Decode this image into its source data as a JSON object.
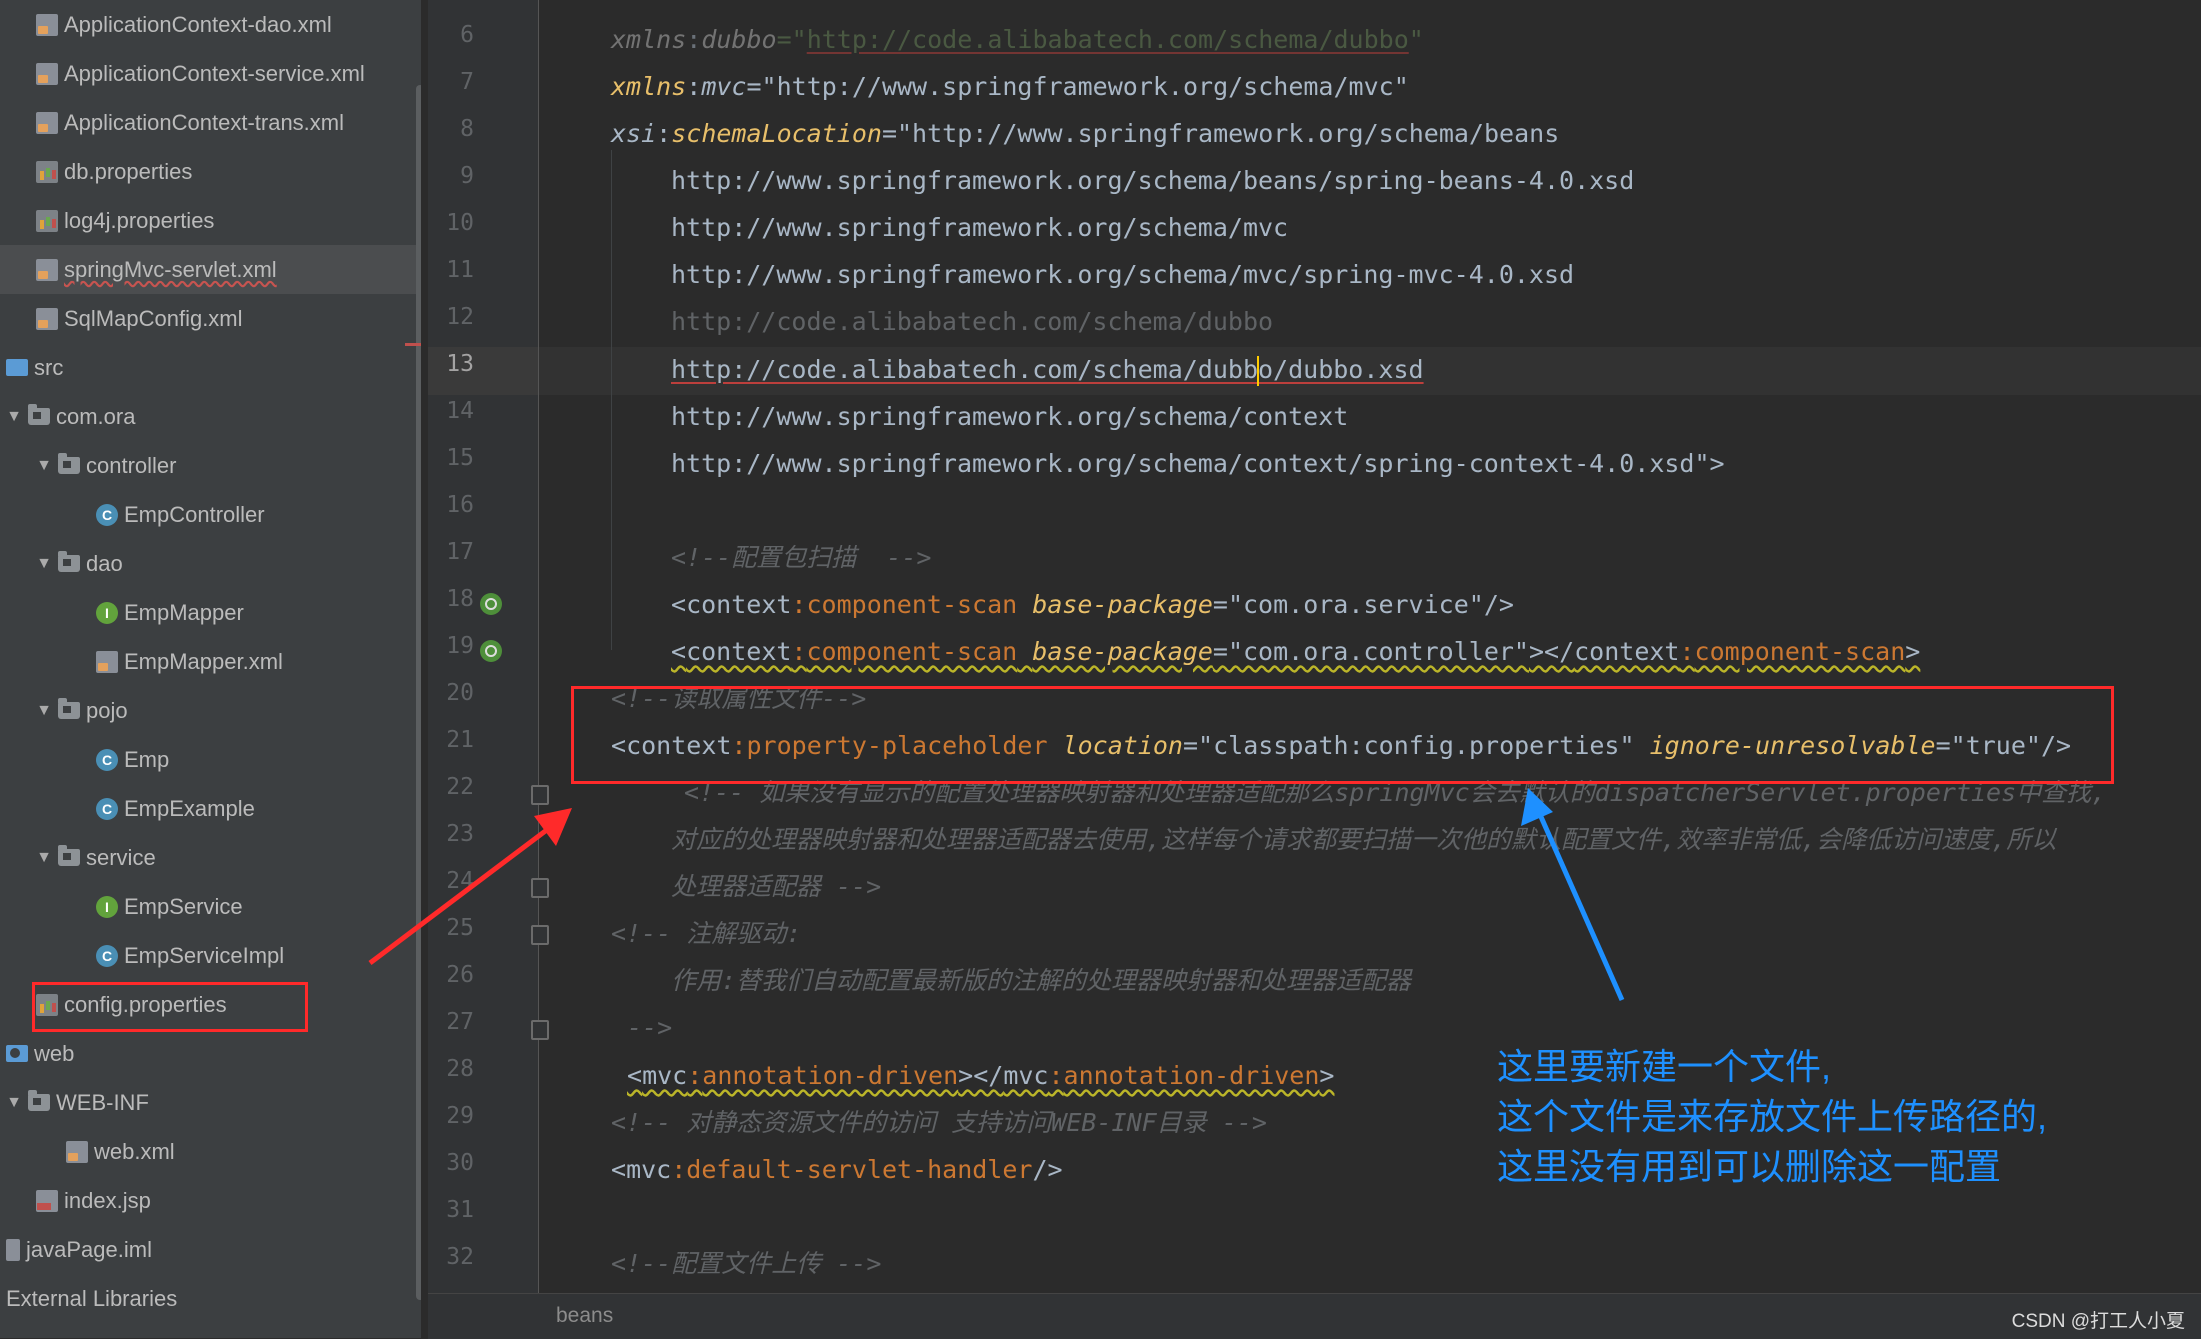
{
  "project_tree": {
    "items": [
      {
        "label": "ApplicationContext-dao.xml",
        "icon": "xml-file-icon",
        "depth": 1
      },
      {
        "label": "ApplicationContext-service.xml",
        "icon": "xml-file-icon",
        "depth": 1
      },
      {
        "label": "ApplicationContext-trans.xml",
        "icon": "xml-file-icon",
        "depth": 1
      },
      {
        "label": "db.properties",
        "icon": "properties-file-icon",
        "depth": 1
      },
      {
        "label": "log4j.properties",
        "icon": "properties-file-icon",
        "depth": 1
      },
      {
        "label": "springMvc-servlet.xml",
        "icon": "xml-file-icon",
        "depth": 1,
        "selected": true
      },
      {
        "label": "SqlMapConfig.xml",
        "icon": "xml-file-icon",
        "depth": 1
      },
      {
        "label": "src",
        "icon": "source-folder-icon",
        "depth": 0
      },
      {
        "label": "com.ora",
        "icon": "package-folder-icon",
        "depth": 0,
        "expanded": true
      },
      {
        "label": "controller",
        "icon": "package-folder-icon",
        "depth": 1,
        "expanded": true
      },
      {
        "label": "EmpController",
        "icon": "class-icon",
        "depth": 3
      },
      {
        "label": "dao",
        "icon": "package-folder-icon",
        "depth": 1,
        "expanded": true
      },
      {
        "label": "EmpMapper",
        "icon": "interface-icon",
        "depth": 3
      },
      {
        "label": "EmpMapper.xml",
        "icon": "xml-file-icon",
        "depth": 3
      },
      {
        "label": "pojo",
        "icon": "package-folder-icon",
        "depth": 1,
        "expanded": true
      },
      {
        "label": "Emp",
        "icon": "class-icon",
        "depth": 3
      },
      {
        "label": "EmpExample",
        "icon": "class-icon",
        "depth": 3
      },
      {
        "label": "service",
        "icon": "package-folder-icon",
        "depth": 1,
        "expanded": true
      },
      {
        "label": "EmpService",
        "icon": "interface-icon",
        "depth": 3
      },
      {
        "label": "EmpServiceImpl",
        "icon": "class-icon",
        "depth": 3
      },
      {
        "label": "config.properties",
        "icon": "properties-file-icon",
        "depth": 1
      },
      {
        "label": "web",
        "icon": "web-folder-icon",
        "depth": 0
      },
      {
        "label": "WEB-INF",
        "icon": "folder-icon",
        "depth": 0,
        "expanded": true
      },
      {
        "label": "web.xml",
        "icon": "xml-file-icon",
        "depth": 2
      },
      {
        "label": "index.jsp",
        "icon": "jsp-file-icon",
        "depth": 1
      },
      {
        "label": "javaPage.iml",
        "icon": "iml-file-icon",
        "depth": 0
      },
      {
        "label": "External Libraries",
        "icon": "",
        "depth": 0
      }
    ]
  },
  "editor": {
    "current_line": "13",
    "line_numbers": [
      "6",
      "7",
      "8",
      "9",
      "10",
      "11",
      "12",
      "13",
      "14",
      "15",
      "16",
      "17",
      "18",
      "19",
      "20",
      "21",
      "22",
      "23",
      "24",
      "25",
      "26",
      "27",
      "28",
      "29",
      "30",
      "31",
      "32"
    ],
    "lines": {
      "l6": {
        "ns": "xmlns",
        "colon": ":",
        "name": "dubbo",
        "eq": "=\"",
        "url": "http://code.alibabatech.com/schema/dubbo",
        "end": "\""
      },
      "l7": {
        "ns": "xmlns",
        "colon": ":",
        "name": "mvc",
        "value": "=\"http://www.springframework.org/schema/mvc\""
      },
      "l8": {
        "ns": "xsi",
        "colon": ":",
        "name": "schemaLocation",
        "value": "=\"http://www.springframework.org/schema/beans"
      },
      "l9": "http://www.springframework.org/schema/beans/spring-beans-4.0.xsd",
      "l10": "http://www.springframework.org/schema/mvc",
      "l11": "http://www.springframework.org/schema/mvc/spring-mvc-4.0.xsd",
      "l12": "http://code.alibabatech.com/schema/dubbo",
      "l13": "http://code.alibabatech.com/schema/dubbo/dubbo.xsd",
      "l14": "http://www.springframework.org/schema/context",
      "l15": "http://www.springframework.org/schema/context/spring-context-4.0.xsd\">",
      "l17": "<!--配置包扫描  -->",
      "l18": {
        "open": "<",
        "tag": "context",
        "colon": ":",
        "name": "component-scan",
        "attr": "base-package",
        "value": "=\"com.ora.service\"",
        "close": "/>"
      },
      "l19": {
        "open": "<",
        "tag": "context",
        "colon": ":",
        "name": "component-scan",
        "attr": "base-package",
        "value": "=\"com.ora.controller\"",
        "mid": "></",
        "tag2": "context",
        "name2": "component-scan",
        "close": ">"
      },
      "l20": "<!--读取属性文件-->",
      "l21": {
        "open": "<",
        "tag": "context",
        "colon": ":",
        "name": "property-placeholder",
        "attr1": "location",
        "value1": "=\"classpath:config.properties\"",
        "attr2": "ignore-unresolvable",
        "value2": "=\"true\"",
        "close": "/>"
      },
      "l22": "<!-- 如果没有显示的配置处理器映射器和处理器适配那么springMvc会去默认的dispatcherServlet.properties中查找,",
      "l23": "对应的处理器映射器和处理器适配器去使用,这样每个请求都要扫描一次他的默认配置文件,效率非常低,会降低访问速度,所以",
      "l24": "处理器适配器 -->",
      "l25": "<!-- 注解驱动:",
      "l26": "作用:替我们自动配置最新版的注解的处理器映射器和处理器适配器",
      "l27": "-->",
      "l28": {
        "open": "<",
        "tag": "mvc",
        "colon": ":",
        "name": "annotation-driven",
        "mid": "></",
        "tag2": "mvc",
        "name2": "annotation-driven",
        "close": ">"
      },
      "l29": "<!-- 对静态资源文件的访问 支持访问WEB-INF目录 -->",
      "l30": {
        "open": "<",
        "tag": "mvc",
        "colon": ":",
        "name": "default-servlet-handler",
        "close": "/>"
      },
      "l32": "<!--配置文件上传 -->"
    }
  },
  "status_bar": {
    "breadcrumb": "beans",
    "watermark": "CSDN @打工人小夏"
  },
  "annotation": {
    "lines": [
      "这里要新建一个文件,",
      "这个文件是来存放文件上传路径的,",
      "这里没有用到可以删除这一配置"
    ],
    "color": "#1e90ff",
    "highlight_color": "#ff2a2a"
  },
  "colors": {
    "tree_bg": "#3c3f41",
    "editor_bg": "#2b2b2b",
    "tag": "#e8bf6a",
    "namespace": "#9876aa",
    "string": "#6a8759",
    "comment": "#629755"
  }
}
